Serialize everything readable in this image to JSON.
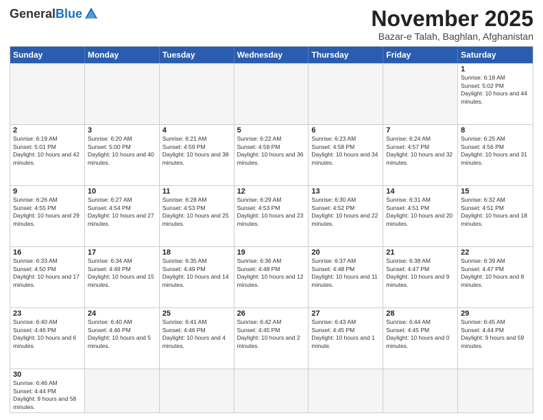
{
  "header": {
    "logo_general": "General",
    "logo_blue": "Blue",
    "month_title": "November 2025",
    "location": "Bazar-e Talah, Baghlan, Afghanistan"
  },
  "calendar": {
    "headers": [
      "Sunday",
      "Monday",
      "Tuesday",
      "Wednesday",
      "Thursday",
      "Friday",
      "Saturday"
    ],
    "rows": [
      [
        {
          "day": "",
          "info": "",
          "empty": true
        },
        {
          "day": "",
          "info": "",
          "empty": true
        },
        {
          "day": "",
          "info": "",
          "empty": true
        },
        {
          "day": "",
          "info": "",
          "empty": true
        },
        {
          "day": "",
          "info": "",
          "empty": true
        },
        {
          "day": "",
          "info": "",
          "empty": true
        },
        {
          "day": "1",
          "info": "Sunrise: 6:18 AM\nSunset: 5:02 PM\nDaylight: 10 hours and 44 minutes."
        }
      ],
      [
        {
          "day": "2",
          "info": "Sunrise: 6:19 AM\nSunset: 5:01 PM\nDaylight: 10 hours and 42 minutes."
        },
        {
          "day": "3",
          "info": "Sunrise: 6:20 AM\nSunset: 5:00 PM\nDaylight: 10 hours and 40 minutes."
        },
        {
          "day": "4",
          "info": "Sunrise: 6:21 AM\nSunset: 4:59 PM\nDaylight: 10 hours and 38 minutes."
        },
        {
          "day": "5",
          "info": "Sunrise: 6:22 AM\nSunset: 4:58 PM\nDaylight: 10 hours and 36 minutes."
        },
        {
          "day": "6",
          "info": "Sunrise: 6:23 AM\nSunset: 4:58 PM\nDaylight: 10 hours and 34 minutes."
        },
        {
          "day": "7",
          "info": "Sunrise: 6:24 AM\nSunset: 4:57 PM\nDaylight: 10 hours and 32 minutes."
        },
        {
          "day": "8",
          "info": "Sunrise: 6:25 AM\nSunset: 4:56 PM\nDaylight: 10 hours and 31 minutes."
        }
      ],
      [
        {
          "day": "9",
          "info": "Sunrise: 6:26 AM\nSunset: 4:55 PM\nDaylight: 10 hours and 29 minutes."
        },
        {
          "day": "10",
          "info": "Sunrise: 6:27 AM\nSunset: 4:54 PM\nDaylight: 10 hours and 27 minutes."
        },
        {
          "day": "11",
          "info": "Sunrise: 6:28 AM\nSunset: 4:53 PM\nDaylight: 10 hours and 25 minutes."
        },
        {
          "day": "12",
          "info": "Sunrise: 6:29 AM\nSunset: 4:53 PM\nDaylight: 10 hours and 23 minutes."
        },
        {
          "day": "13",
          "info": "Sunrise: 6:30 AM\nSunset: 4:52 PM\nDaylight: 10 hours and 22 minutes."
        },
        {
          "day": "14",
          "info": "Sunrise: 6:31 AM\nSunset: 4:51 PM\nDaylight: 10 hours and 20 minutes."
        },
        {
          "day": "15",
          "info": "Sunrise: 6:32 AM\nSunset: 4:51 PM\nDaylight: 10 hours and 18 minutes."
        }
      ],
      [
        {
          "day": "16",
          "info": "Sunrise: 6:33 AM\nSunset: 4:50 PM\nDaylight: 10 hours and 17 minutes."
        },
        {
          "day": "17",
          "info": "Sunrise: 6:34 AM\nSunset: 4:49 PM\nDaylight: 10 hours and 15 minutes."
        },
        {
          "day": "18",
          "info": "Sunrise: 6:35 AM\nSunset: 4:49 PM\nDaylight: 10 hours and 14 minutes."
        },
        {
          "day": "19",
          "info": "Sunrise: 6:36 AM\nSunset: 4:48 PM\nDaylight: 10 hours and 12 minutes."
        },
        {
          "day": "20",
          "info": "Sunrise: 6:37 AM\nSunset: 4:48 PM\nDaylight: 10 hours and 11 minutes."
        },
        {
          "day": "21",
          "info": "Sunrise: 6:38 AM\nSunset: 4:47 PM\nDaylight: 10 hours and 9 minutes."
        },
        {
          "day": "22",
          "info": "Sunrise: 6:39 AM\nSunset: 4:47 PM\nDaylight: 10 hours and 8 minutes."
        }
      ],
      [
        {
          "day": "23",
          "info": "Sunrise: 6:40 AM\nSunset: 4:46 PM\nDaylight: 10 hours and 6 minutes."
        },
        {
          "day": "24",
          "info": "Sunrise: 6:40 AM\nSunset: 4:46 PM\nDaylight: 10 hours and 5 minutes."
        },
        {
          "day": "25",
          "info": "Sunrise: 6:41 AM\nSunset: 4:46 PM\nDaylight: 10 hours and 4 minutes."
        },
        {
          "day": "26",
          "info": "Sunrise: 6:42 AM\nSunset: 4:45 PM\nDaylight: 10 hours and 2 minutes."
        },
        {
          "day": "27",
          "info": "Sunrise: 6:43 AM\nSunset: 4:45 PM\nDaylight: 10 hours and 1 minute."
        },
        {
          "day": "28",
          "info": "Sunrise: 6:44 AM\nSunset: 4:45 PM\nDaylight: 10 hours and 0 minutes."
        },
        {
          "day": "29",
          "info": "Sunrise: 6:45 AM\nSunset: 4:44 PM\nDaylight: 9 hours and 59 minutes."
        }
      ],
      [
        {
          "day": "30",
          "info": "Sunrise: 6:46 AM\nSunset: 4:44 PM\nDaylight: 9 hours and 58 minutes."
        },
        {
          "day": "",
          "info": "",
          "empty": true
        },
        {
          "day": "",
          "info": "",
          "empty": true
        },
        {
          "day": "",
          "info": "",
          "empty": true
        },
        {
          "day": "",
          "info": "",
          "empty": true
        },
        {
          "day": "",
          "info": "",
          "empty": true
        },
        {
          "day": "",
          "info": "",
          "empty": true
        }
      ]
    ]
  }
}
